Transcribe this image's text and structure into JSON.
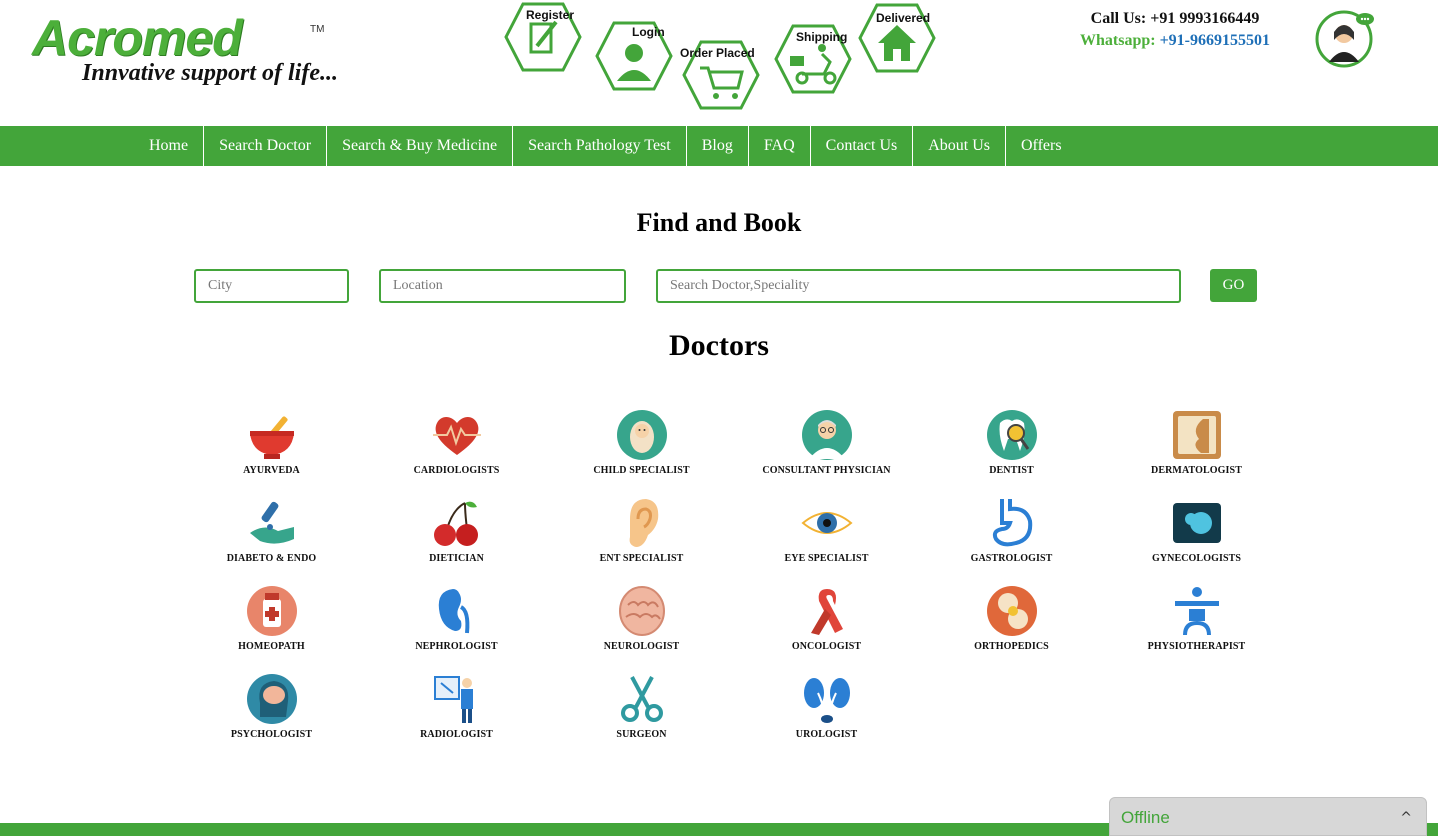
{
  "brand": {
    "logo_text": "Acromed",
    "trademark": "TM",
    "tagline": "Innvative support of life..."
  },
  "steps": [
    {
      "label": "Register",
      "icon": "register-icon"
    },
    {
      "label": "Login",
      "icon": "login-user-icon"
    },
    {
      "label": "Order Placed",
      "icon": "cart-icon"
    },
    {
      "label": "Shipping",
      "icon": "scooter-icon"
    },
    {
      "label": "Delivered",
      "icon": "house-icon"
    }
  ],
  "contact": {
    "call_label": "Call Us: +91 9993166449",
    "whatsapp_label": "Whatsapp: ",
    "whatsapp_number": "+91-9669155501"
  },
  "nav": {
    "items": [
      "Home",
      "Search Doctor",
      "Search & Buy Medicine",
      "Search Pathology Test",
      "Blog",
      "FAQ",
      "Contact Us",
      "About Us",
      "Offers"
    ]
  },
  "find": {
    "title": "Find and Book",
    "city_placeholder": "City",
    "location_placeholder": "Location",
    "search_placeholder": "Search Doctor,Speciality",
    "go_label": "GO"
  },
  "doctors": {
    "title": "Doctors",
    "specialties": [
      {
        "label": "AYURVEDA",
        "icon": "mortar-pestle-icon"
      },
      {
        "label": "CARDIOLOGISTS",
        "icon": "heart-pulse-icon"
      },
      {
        "label": "CHILD SPECIALIST",
        "icon": "baby-icon"
      },
      {
        "label": "CONSULTANT PHYSICIAN",
        "icon": "doctor-icon"
      },
      {
        "label": "DENTIST",
        "icon": "tooth-icon"
      },
      {
        "label": "DERMATOLOGIST",
        "icon": "skin-face-icon"
      },
      {
        "label": "DIABETO & ENDO",
        "icon": "glucose-hand-icon"
      },
      {
        "label": "DIETICIAN",
        "icon": "cherries-icon"
      },
      {
        "label": "ENT SPECIALIST",
        "icon": "ear-icon"
      },
      {
        "label": "EYE SPECIALIST",
        "icon": "eye-icon"
      },
      {
        "label": "GASTROLOGIST",
        "icon": "stomach-icon"
      },
      {
        "label": "GYNECOLOGISTS",
        "icon": "fetus-scan-icon"
      },
      {
        "label": "HOMEOPATH",
        "icon": "medicine-bottle-icon"
      },
      {
        "label": "NEPHROLOGIST",
        "icon": "kidney-icon"
      },
      {
        "label": "NEUROLOGIST",
        "icon": "brain-icon"
      },
      {
        "label": "ONCOLOGIST",
        "icon": "cancer-ribbon-icon"
      },
      {
        "label": "ORTHOPEDICS",
        "icon": "bone-joint-icon"
      },
      {
        "label": "PHYSIOTHERAPIST",
        "icon": "physio-icon"
      },
      {
        "label": "PSYCHOLOGIST",
        "icon": "head-brain-icon"
      },
      {
        "label": "RADIOLOGIST",
        "icon": "xray-icon"
      },
      {
        "label": "SURGEON",
        "icon": "scissors-icon"
      },
      {
        "label": "UROLOGIST",
        "icon": "urinary-icon"
      }
    ]
  },
  "chat": {
    "status": "Offline",
    "caret": "^"
  },
  "colors": {
    "brand_green": "#43a53a",
    "whatsapp_blue": "#1e6fb7"
  }
}
